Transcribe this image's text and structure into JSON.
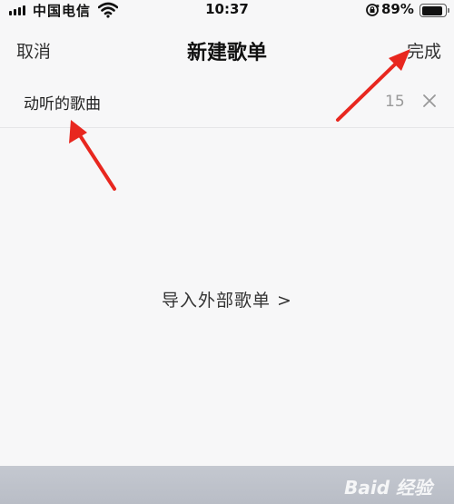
{
  "status_bar": {
    "carrier": "中国电信",
    "time": "10:37",
    "battery_percent": "89%",
    "battery_level": 0.89,
    "icons": [
      "signal-icon",
      "wifi-icon",
      "rotation-lock-icon",
      "battery-icon"
    ]
  },
  "nav": {
    "cancel_label": "取消",
    "title": "新建歌单",
    "done_label": "完成"
  },
  "name_field": {
    "value": "动听的歌曲",
    "char_count": "15",
    "clear_icon": "close-icon"
  },
  "import_link": "导入外部歌单 >",
  "watermark": "Baid 经验",
  "colors": {
    "annotation_arrow": "#e8271f",
    "background": "#f7f7f8",
    "bottom_bar": "#bfc3cb"
  }
}
